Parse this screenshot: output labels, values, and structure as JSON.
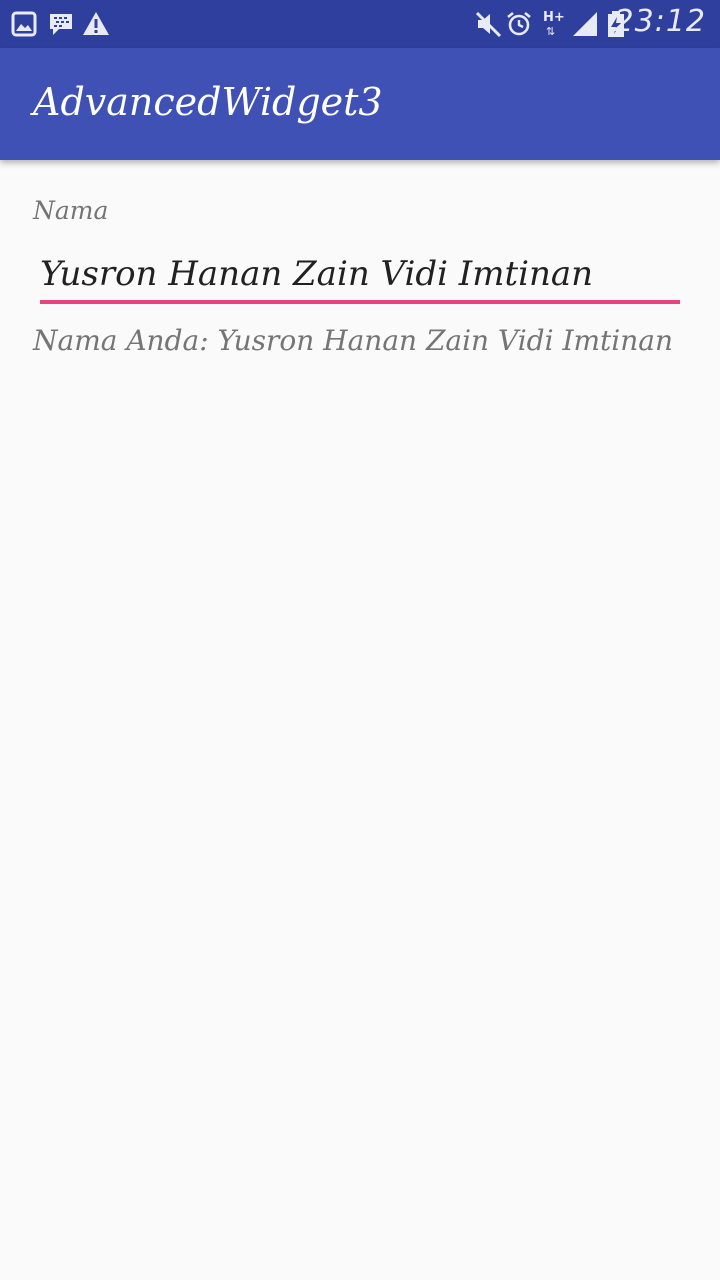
{
  "status_bar": {
    "left_icons": [
      "image-icon",
      "bbm-icon",
      "warning-icon"
    ],
    "right_icons": [
      "mute-icon",
      "alarm-icon",
      "hplus-data-icon",
      "signal-icon",
      "battery-charging-icon"
    ],
    "hplus_label": "H+",
    "time": "23:12"
  },
  "app_bar": {
    "title": "AdvancedWidget3"
  },
  "form": {
    "label": "Nama",
    "input_value": "Yusron Hanan Zain Vidi Imtinan",
    "result_text": "Nama Anda: Yusron Hanan Zain Vidi Imtinan"
  },
  "colors": {
    "status_bar": "#2f3f9e",
    "app_bar": "#3f51b5",
    "accent": "#e6457f",
    "background": "#fafafa"
  }
}
